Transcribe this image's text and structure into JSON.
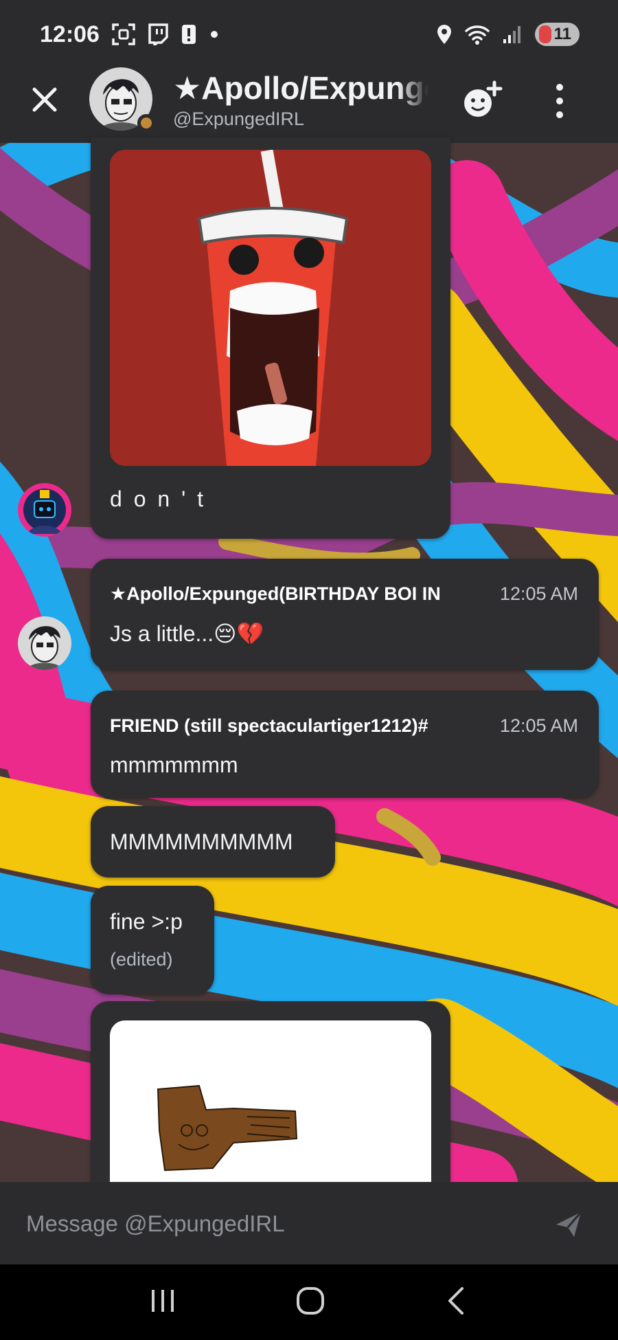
{
  "status_bar": {
    "time": "12:06",
    "battery": "11",
    "icons": [
      "screenshot-icon",
      "twitch-icon",
      "alert-icon",
      "dot-icon",
      "location-icon",
      "wifi-icon",
      "signal-icon",
      "battery-icon"
    ]
  },
  "header": {
    "title": "★Apollo/Expunged(BIRTHDAY BOI",
    "subtitle": "@ExpungedIRL",
    "icons": [
      "close-icon",
      "add-friend-icon",
      "more-vertical-icon"
    ]
  },
  "messages": [
    {
      "id": "m1",
      "caption": "d o n ' t",
      "image": "cartoon-cup-screaming"
    },
    {
      "id": "m2",
      "author": "★Apollo/Expunged(BIRTHDAY BOI IN",
      "time": "12:05 AM",
      "text": "Js a little...😔💔"
    },
    {
      "id": "m3",
      "author": "FRIEND (still spectaculartiger1212)#",
      "time": "12:05 AM",
      "text": "mmmmmmm"
    },
    {
      "id": "m4",
      "text": "MMMMMMMMMM"
    },
    {
      "id": "m5",
      "text": "fine >:p",
      "edited": "(edited)"
    },
    {
      "id": "m6",
      "image": "brown-hand-drawing"
    }
  ],
  "composer": {
    "placeholder": "Message @ExpungedIRL",
    "icons": [
      "send-icon"
    ]
  },
  "nav_bar": {
    "icons": [
      "recents-icon",
      "home-icon",
      "back-icon"
    ]
  },
  "colors": {
    "background": "#2b2d31",
    "bubble": "#2e2e30",
    "wallpaper_pink": "#ec2a8c",
    "wallpaper_yellow": "#f4c60b",
    "wallpaper_blue": "#21a9ee",
    "wallpaper_purple": "#9a3e8e",
    "wallpaper_brown": "#4a3838",
    "status_idle": "#c08a3a",
    "cup_red": "#e8412f"
  }
}
